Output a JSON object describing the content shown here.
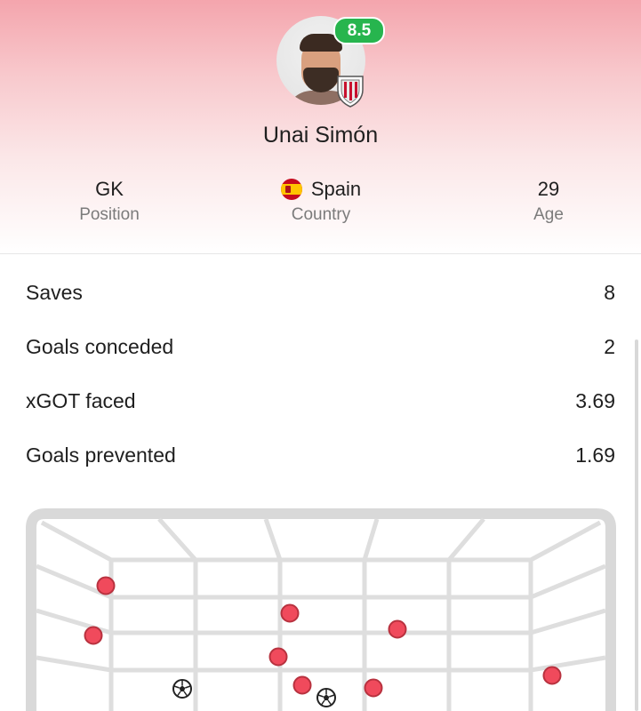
{
  "player": {
    "name": "Unai Simón",
    "rating": "8.5",
    "rating_color": "#27b54e",
    "avatar_icon": "player-photo",
    "club_icon": "athletic-club-badge"
  },
  "info": [
    {
      "value": "GK",
      "label": "Position"
    },
    {
      "value": "Spain",
      "label": "Country",
      "icon": "spain-flag-icon"
    },
    {
      "value": "29",
      "label": "Age"
    }
  ],
  "stats": [
    {
      "label": "Saves",
      "value": "8"
    },
    {
      "label": "Goals conceded",
      "value": "2"
    },
    {
      "label": "xGOT faced",
      "value": "3.69"
    },
    {
      "label": "Goals prevented",
      "value": "1.69"
    }
  ],
  "goal_map": {
    "save_color": "#f04a5c",
    "saves_count": 8,
    "goals_count": 2,
    "goal_icon": "football-icon"
  },
  "colors": {
    "header_gradient_top": "#f4a5ad",
    "text_primary": "#1f1f1f",
    "text_secondary": "#7b7b7b"
  }
}
